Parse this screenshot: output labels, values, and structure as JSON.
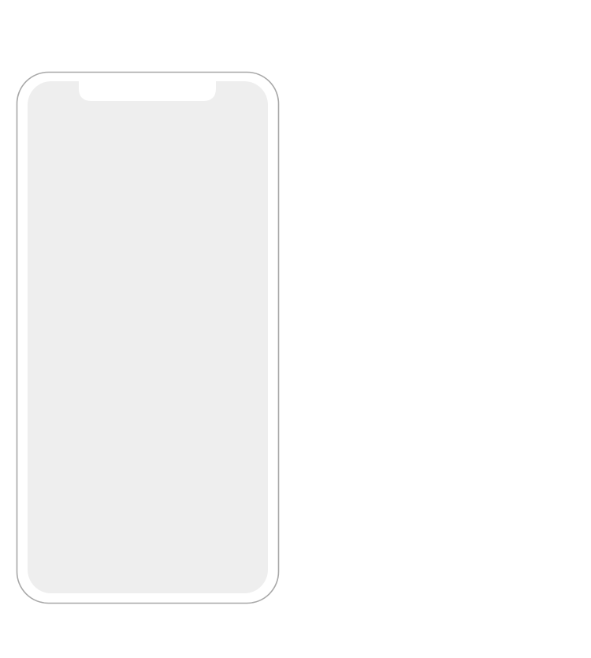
{
  "device": {
    "kind": "phone-frame",
    "frame_fill": "#ffffff",
    "frame_stroke": "#a8a8a8",
    "screen_fill": "#eeeeee",
    "notch_fill": "#ffffff"
  },
  "background": "#ffffff"
}
